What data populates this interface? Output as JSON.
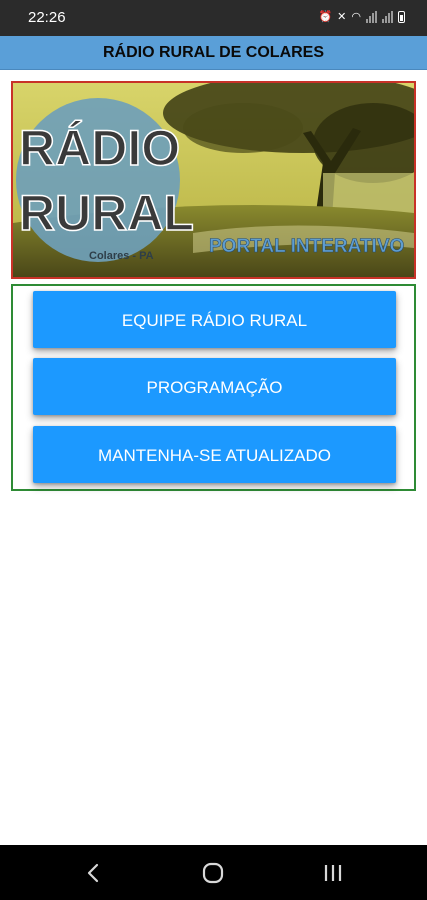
{
  "status": {
    "time": "22:26"
  },
  "app": {
    "title": "RÁDIO RURAL DE COLARES"
  },
  "banner": {
    "logo_line1": "RÁDIO",
    "logo_line2": "RURAL",
    "location": "Colares - PA",
    "tagline": "PORTAL INTERATIVO"
  },
  "menu": [
    {
      "label": "EQUIPE RÁDIO RURAL"
    },
    {
      "label": "PROGRAMAÇÃO"
    },
    {
      "label": "MANTENHA-SE ATUALIZADO"
    }
  ],
  "colors": {
    "app_bar": "#5a9fd8",
    "button": "#1c99ff",
    "banner_border": "#c83228",
    "buttons_border": "#2e8b35"
  },
  "nav": {
    "icons": [
      "back-icon",
      "home-icon",
      "recents-icon"
    ]
  }
}
